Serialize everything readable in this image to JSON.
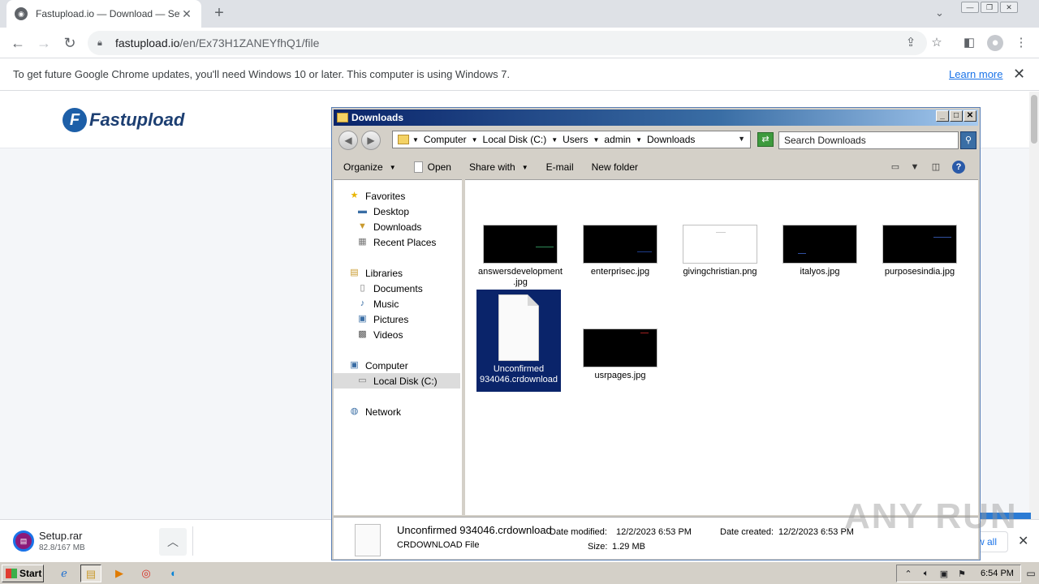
{
  "browser": {
    "tab_title": "Fastupload.io — Download — Setup",
    "url_domain": "fastupload.io",
    "url_path": "/en/Ex73H1ZANEYfhQ1/file",
    "infobar_text": "To get future Google Chrome updates, you'll need Windows 10 or later. This computer is using Windows 7.",
    "infobar_link": "Learn more"
  },
  "site": {
    "logo_text": "Fastupload",
    "logo_mark": "F"
  },
  "downloads_bar": {
    "file_name": "Setup.rar",
    "file_progress": "82.8/167 MB",
    "show_all": "w all"
  },
  "explorer": {
    "title": "Downloads",
    "breadcrumbs": [
      "Computer",
      "Local Disk (C:)",
      "Users",
      "admin",
      "Downloads"
    ],
    "search_placeholder": "Search Downloads",
    "commands": {
      "organize": "Organize",
      "open": "Open",
      "share_with": "Share with",
      "email": "E-mail",
      "new_folder": "New folder"
    },
    "nav": {
      "favorites": "Favorites",
      "desktop": "Desktop",
      "downloads": "Downloads",
      "recent_places": "Recent Places",
      "libraries": "Libraries",
      "documents": "Documents",
      "music": "Music",
      "pictures": "Pictures",
      "videos": "Videos",
      "computer": "Computer",
      "local_disk": "Local Disk (C:)",
      "network": "Network"
    },
    "files": [
      {
        "name": "answersdevelopment.jpg",
        "thumb": "black"
      },
      {
        "name": "enterprisec.jpg",
        "thumb": "black"
      },
      {
        "name": "givingchristian.png",
        "thumb": "white"
      },
      {
        "name": "italyos.jpg",
        "thumb": "black"
      },
      {
        "name": "purposesindia.jpg",
        "thumb": "black"
      },
      {
        "name": "Unconfirmed 934046.crdownload",
        "thumb": "document"
      },
      {
        "name": "usrpages.jpg",
        "thumb": "black"
      }
    ],
    "status": {
      "name": "Unconfirmed 934046.crdownload",
      "type": "CRDOWNLOAD File",
      "modified_label": "Date modified:",
      "modified_value": "12/2/2023 6:53 PM",
      "created_label": "Date created:",
      "created_value": "12/2/2023 6:53 PM",
      "size_label": "Size:",
      "size_value": "1.29 MB"
    }
  },
  "taskbar": {
    "start": "Start",
    "clock": "6:54 PM"
  },
  "watermark": "ANY RUN"
}
